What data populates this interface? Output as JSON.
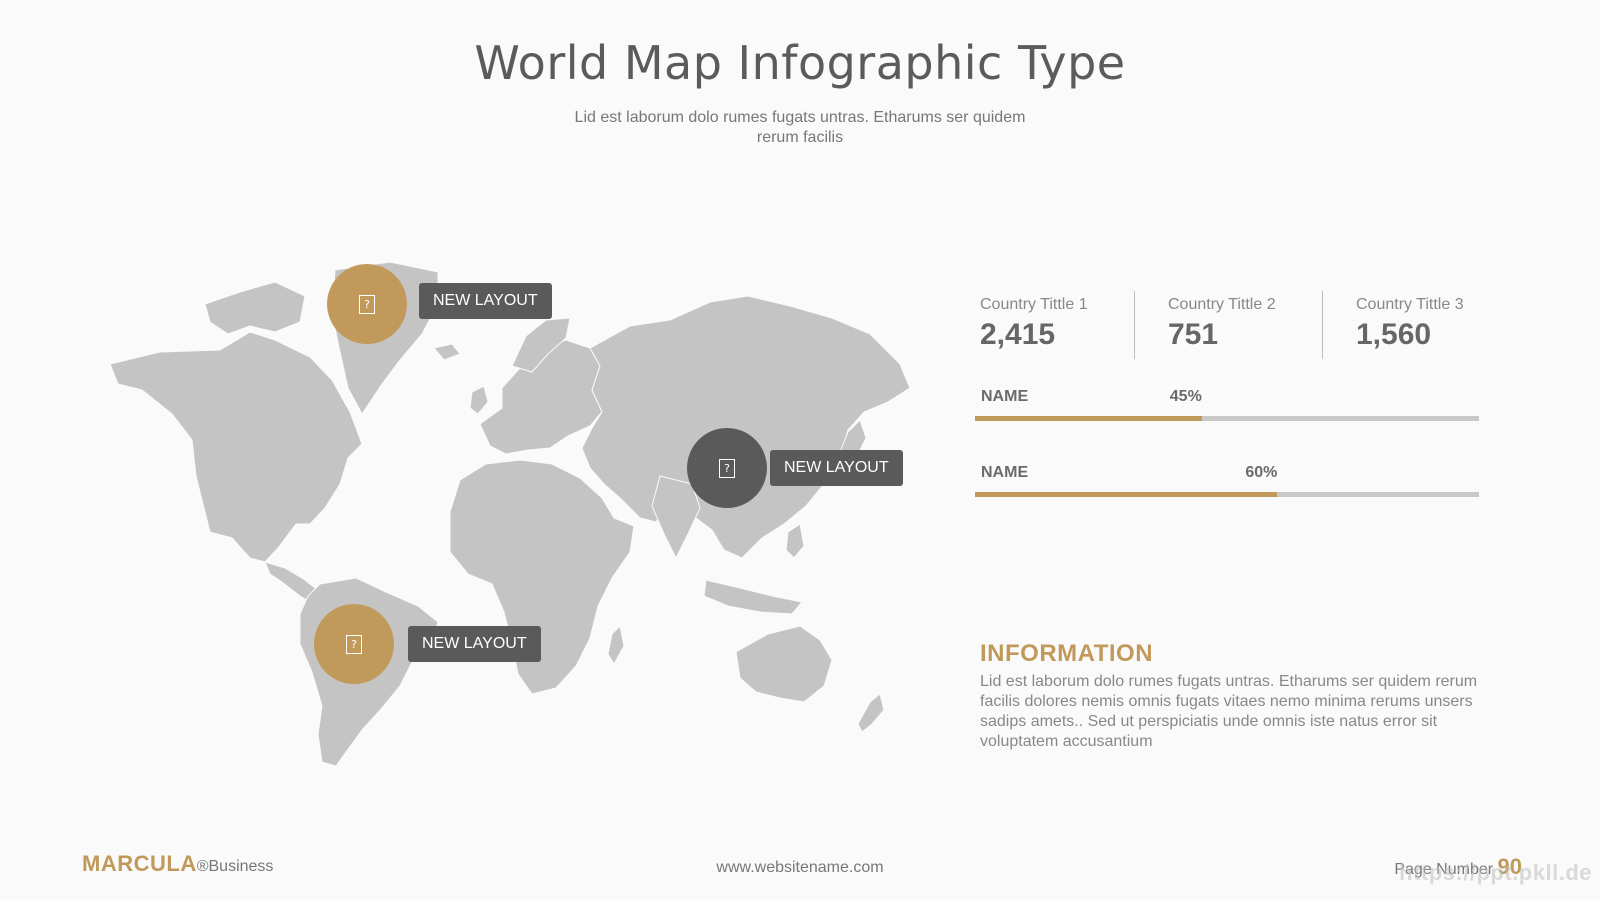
{
  "header": {
    "title": "World Map Infographic Type",
    "subtitle": "Lid est laborum dolo rumes fugats untras. Etharums ser quidem rerum facilis"
  },
  "map": {
    "land_color": "#c4c4c4",
    "markers": [
      {
        "label": "NEW LAYOUT",
        "color": "#c19a5b",
        "icon": "image-placeholder-icon"
      },
      {
        "label": "NEW LAYOUT",
        "color": "#5a5a5a",
        "icon": "image-placeholder-icon"
      },
      {
        "label": "NEW LAYOUT",
        "color": "#c19a5b",
        "icon": "image-placeholder-icon"
      }
    ]
  },
  "stats": [
    {
      "label": "Country Tittle 1",
      "value": "2,415"
    },
    {
      "label": "Country Tittle 2",
      "value": "751"
    },
    {
      "label": "Country Tittle 3",
      "value": "1,560"
    }
  ],
  "bars": [
    {
      "name": "NAME",
      "percent_label": "45%",
      "percent": 45
    },
    {
      "name": "NAME",
      "percent_label": "60%",
      "percent": 60
    }
  ],
  "information": {
    "title": "INFORMATION",
    "text": "Lid est laborum dolo rumes fugats untras. Etharums ser quidem rerum facilis dolores nemis omnis fugats vitaes nemo minima rerums unsers sadips amets.. Sed ut perspiciatis unde omnis iste natus error sit voluptatem accusantium"
  },
  "footer": {
    "brand_name": "MARCULA",
    "brand_suffix": "®Business",
    "website": "www.websitename.com",
    "page_label": "Page Number",
    "page_number": "90",
    "watermark": "https://ppt.pkll.de"
  },
  "colors": {
    "accent": "#c19a5b",
    "dark": "#5a5a5a",
    "track": "#c8c8c8"
  }
}
